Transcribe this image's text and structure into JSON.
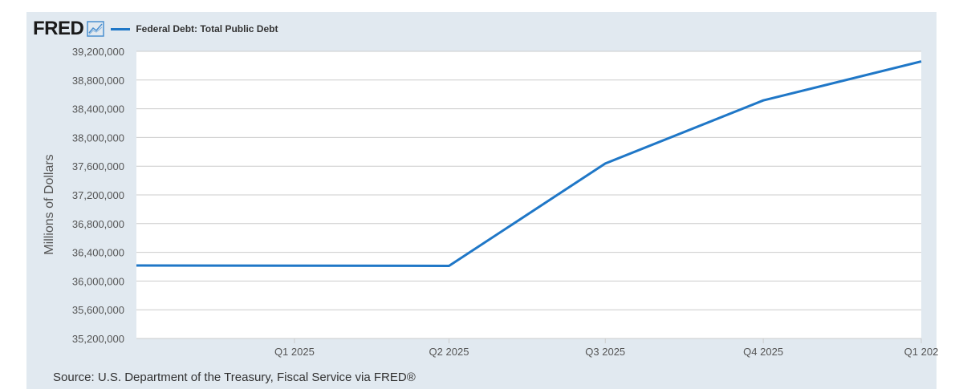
{
  "header": {
    "logo_text": "FRED",
    "logo_icon": "trend-chart-icon"
  },
  "source_text": "Source: U.S. Department of the Treasury, Fiscal Service via FRED®",
  "colors": {
    "series_line": "#1f77c7",
    "frame_background": "#e1e9f0",
    "plot_background": "#ffffff",
    "gridline": "#cccccc"
  },
  "chart_data": {
    "type": "line",
    "ylabel": "Millions of Dollars",
    "series": [
      {
        "name": "Federal Debt: Total Public Debt",
        "x": [
          "2024-10-01",
          "2025-01-01",
          "2025-04-01",
          "2025-07-01",
          "2025-10-01",
          "2026-01-01"
        ],
        "values": [
          36217000,
          36214000,
          36211000,
          37637000,
          38516000,
          39059000
        ]
      }
    ],
    "xticks": [
      "Q1 2025",
      "Q2 2025",
      "Q3 2025",
      "Q4 2025",
      "Q1 202"
    ],
    "xtick_dates": [
      "2025-01-01",
      "2025-04-01",
      "2025-07-01",
      "2025-10-01",
      "2026-01-01"
    ],
    "yticks": [
      35200000,
      35600000,
      36000000,
      36400000,
      36800000,
      37200000,
      37600000,
      38000000,
      38400000,
      38800000,
      39200000
    ],
    "ytick_labels": [
      "35,200,000",
      "35,600,000",
      "36,000,000",
      "36,400,000",
      "36,800,000",
      "37,200,000",
      "37,600,000",
      "38,000,000",
      "38,400,000",
      "38,800,000",
      "39,200,000"
    ],
    "xlim": [
      "2024-10-01",
      "2026-01-01"
    ],
    "ylim": [
      35200000,
      39200000
    ],
    "grid": "horizontal",
    "legend_position": "top-left"
  }
}
